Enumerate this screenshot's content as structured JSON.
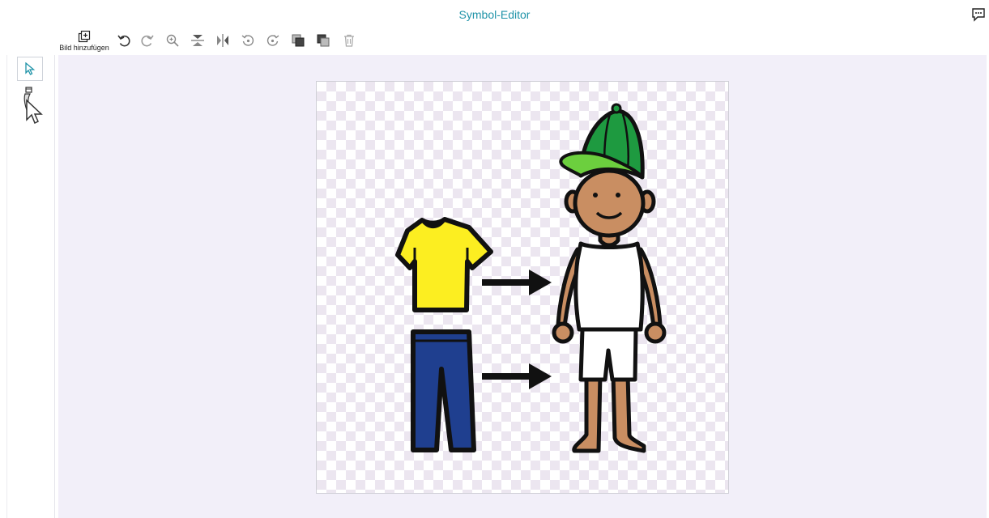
{
  "window": {
    "title": "Symbol-Editor"
  },
  "toolbar": {
    "add_image_label": "Bild hinzufügen",
    "buttons": [
      "undo-icon",
      "redo-icon",
      "crop-zoom-icon",
      "flip-vertical-icon",
      "flip-horizontal-icon",
      "rotate-left-icon",
      "rotate-right-icon",
      "bring-forward-icon",
      "send-backward-icon",
      "delete-icon"
    ]
  },
  "tools": [
    "select-pointer-icon",
    "eraser-icon"
  ],
  "colors": {
    "accent": "#1f93a8",
    "workspace": "#f2eff9",
    "shirt": "#fcee21",
    "pants": "#1f3f8f",
    "cap": "#1e9a40",
    "cap_brim": "#6ccf3e",
    "skin": "#c98e62"
  }
}
